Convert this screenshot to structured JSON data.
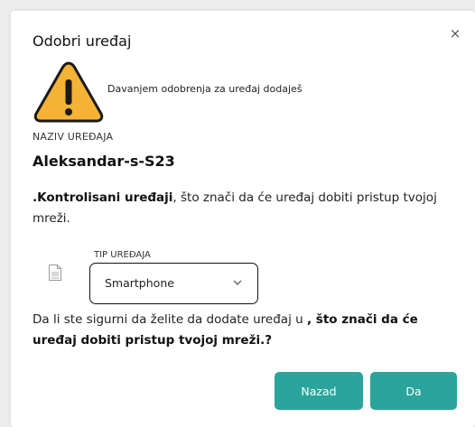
{
  "dialog": {
    "title": "Odobri uređaj",
    "close_symbol": "×",
    "warning_icon": "warning-triangle-icon",
    "warning_text": "Davanjem odobrenja za uređaj dodaješ",
    "device_field_label": "NAZIV UREĐAJA",
    "device_name": "Aleksandar-s-S23",
    "description_bold": ".Kontrolisani uređaji",
    "description_rest": ", što znači da će uređaj dobiti pristup tvojoj mreži.",
    "device_type_label": "TIP UREĐAJA",
    "device_type_icon": "device-type-icon",
    "device_type_value": "Smartphone",
    "confirm_prefix": "Da li ste sigurni da želite da dodate uređaj u ",
    "confirm_bold": ", što znači da će uređaj dobiti pristup tvojoj mreži.?",
    "back_button": "Nazad",
    "yes_button": "Da"
  },
  "colors": {
    "accent": "#2ba59b",
    "warning_fill": "#f4b335",
    "text": "#222222"
  }
}
